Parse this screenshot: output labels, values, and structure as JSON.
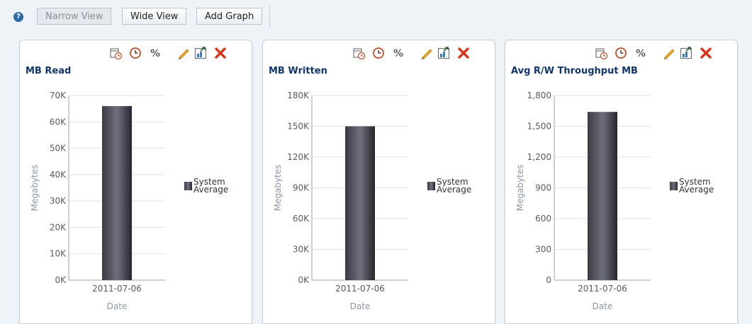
{
  "toolbar": {
    "help_label": "?",
    "narrow_view": "Narrow View",
    "wide_view": "Wide View",
    "add_graph": "Add Graph"
  },
  "panel_icons": [
    "calendar-icon",
    "clock-icon",
    "percent-icon",
    "edit-icon",
    "export-icon",
    "close-icon"
  ],
  "percent_glyph": "%",
  "colors": {
    "bar_dark": "#25252d",
    "bar_light": "#6a6a78",
    "title": "#11366b",
    "close": "#d9331a"
  },
  "chart_data": [
    {
      "type": "bar",
      "title": "MB Read",
      "xlabel": "Date",
      "ylabel": "Megabytes",
      "categories": [
        "2011-07-06"
      ],
      "series": [
        {
          "name": "System Average",
          "values": [
            66000
          ]
        }
      ],
      "legend_lines": [
        "System",
        "Average"
      ],
      "yticks": [
        "0K",
        "10K",
        "20K",
        "30K",
        "40K",
        "50K",
        "60K",
        "70K"
      ],
      "ylim": [
        0,
        70000
      ],
      "grid": true,
      "legend": "right"
    },
    {
      "type": "bar",
      "title": "MB Written",
      "xlabel": "Date",
      "ylabel": "Megabytes",
      "categories": [
        "2011-07-06"
      ],
      "series": [
        {
          "name": "System Average",
          "values": [
            150000
          ]
        }
      ],
      "legend_lines": [
        "System",
        "Average"
      ],
      "yticks": [
        "0K",
        "30K",
        "60K",
        "90K",
        "120K",
        "150K",
        "180K"
      ],
      "ylim": [
        0,
        180000
      ],
      "grid": true,
      "legend": "right"
    },
    {
      "type": "bar",
      "title": "Avg R/W Throughput MB",
      "xlabel": "Date",
      "ylabel": "Megabytes",
      "categories": [
        "2011-07-06"
      ],
      "series": [
        {
          "name": "System Average",
          "values": [
            1640
          ]
        }
      ],
      "legend_lines": [
        "System",
        "Average"
      ],
      "yticks": [
        "0",
        "300",
        "600",
        "900",
        "1,200",
        "1,500",
        "1,800"
      ],
      "ylim": [
        0,
        1800
      ],
      "grid": true,
      "legend": "right"
    }
  ]
}
